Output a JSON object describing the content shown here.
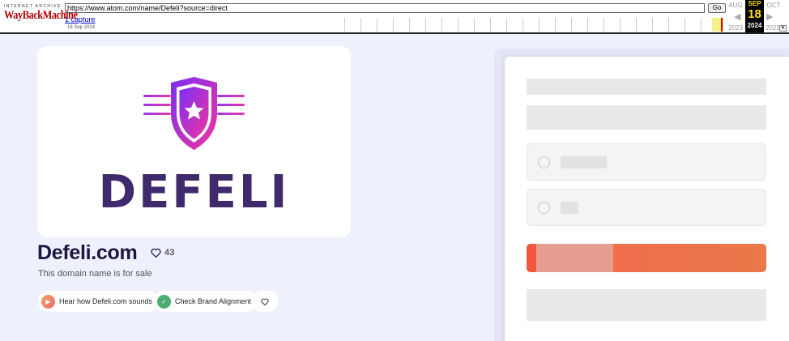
{
  "wayback": {
    "brand_top": "INTERNET ARCHIVE",
    "brand_name": "WayBackMachine",
    "url": "https://www.atom.com/name/Defeli?source=direct",
    "go_label": "Go",
    "captures": "1 capture",
    "capture_date": "18 Sep 2024",
    "prev_month": "AUG",
    "cur_month": "SEP",
    "next_month": "OCT",
    "cur_day": "18",
    "prev_year": "2023",
    "cur_year": "2024",
    "next_year": "2025"
  },
  "listing": {
    "logo_word": "DEFELI",
    "domain": "Defeli.com",
    "likes": "43",
    "subtitle": "This domain name is for sale",
    "actions": [
      {
        "label": "Hear how Defeli.com sounds",
        "icon": "play-icon",
        "color": "#f2836a"
      },
      {
        "label": "Check Brand Alignment",
        "icon": "check-icon",
        "color": "#4cae72"
      }
    ]
  },
  "colors": {
    "brand_purple": "#3f2a6b",
    "shield_gradient_start": "#7b2ff7",
    "shield_gradient_end": "#f0349b",
    "cta_orange": "#f46a4e"
  }
}
